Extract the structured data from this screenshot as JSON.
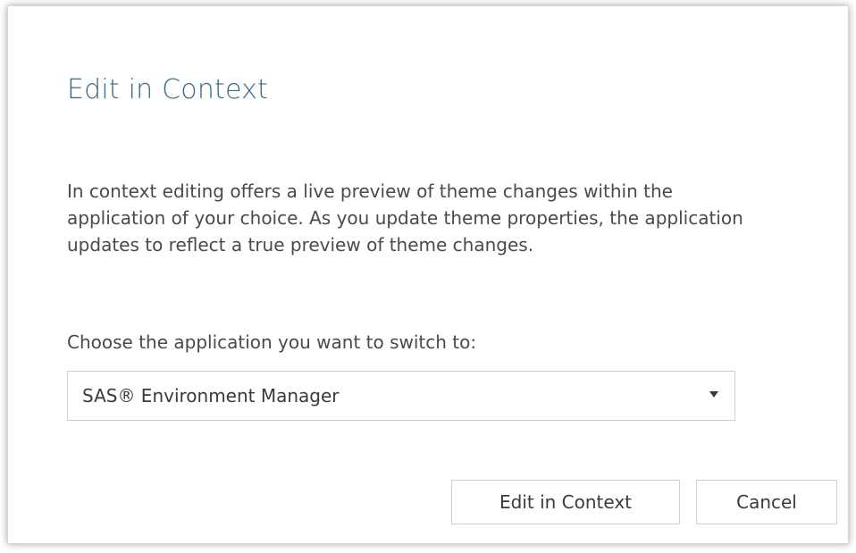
{
  "dialog": {
    "title": "Edit in Context",
    "description": "In context editing offers a live preview of theme changes within the application of your choice. As you update theme properties, the application updates to reflect a true preview of theme changes.",
    "prompt": "Choose the application you want to switch to:",
    "select": {
      "selected": "SAS® Environment Manager",
      "arrow_icon": "caret-down-icon"
    },
    "buttons": {
      "edit_label": "Edit in Context",
      "cancel_label": "Cancel"
    }
  },
  "colors": {
    "title": "#3a6a86",
    "text": "#4a4a4a",
    "border": "#cfcfcf"
  }
}
